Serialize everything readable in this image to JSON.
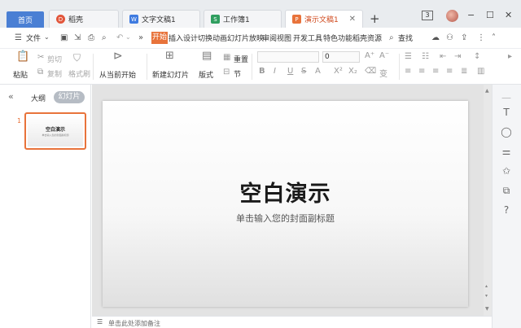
{
  "tabs": {
    "home": "首页",
    "docer": "稻壳",
    "writer": "文字文稿1",
    "sheet": "工作簿1",
    "presentation": "演示文稿1"
  },
  "window": {
    "badge": "3"
  },
  "menu": {
    "file": "文件",
    "start": "开始",
    "items": [
      "插入",
      "设计",
      "切换",
      "动画",
      "幻灯片放映",
      "审阅",
      "视图",
      "开发工具",
      "特色功能",
      "稻壳资源"
    ],
    "search": "查找"
  },
  "ribbon": {
    "paste": "粘贴",
    "cut": "剪切",
    "copy": "复制",
    "format_painter": "格式刷",
    "from_current": "从当前开始",
    "new_slide": "新建幻灯片",
    "layout": "版式",
    "section": "节",
    "reset": "重置",
    "font_size": "0"
  },
  "left_panel": {
    "outline_tab": "大纲",
    "slides_tab": "幻灯片",
    "slide_number": "1",
    "thumb_title": "空白演示",
    "thumb_subtitle": "单击输入您的封面副标题"
  },
  "slide": {
    "title": "空白演示",
    "subtitle": "单击输入您的封面副标题"
  },
  "notes": {
    "placeholder": "单击此处添加备注"
  },
  "colors": {
    "accent": "#e8733b",
    "home_tab": "#4a7fd4"
  }
}
